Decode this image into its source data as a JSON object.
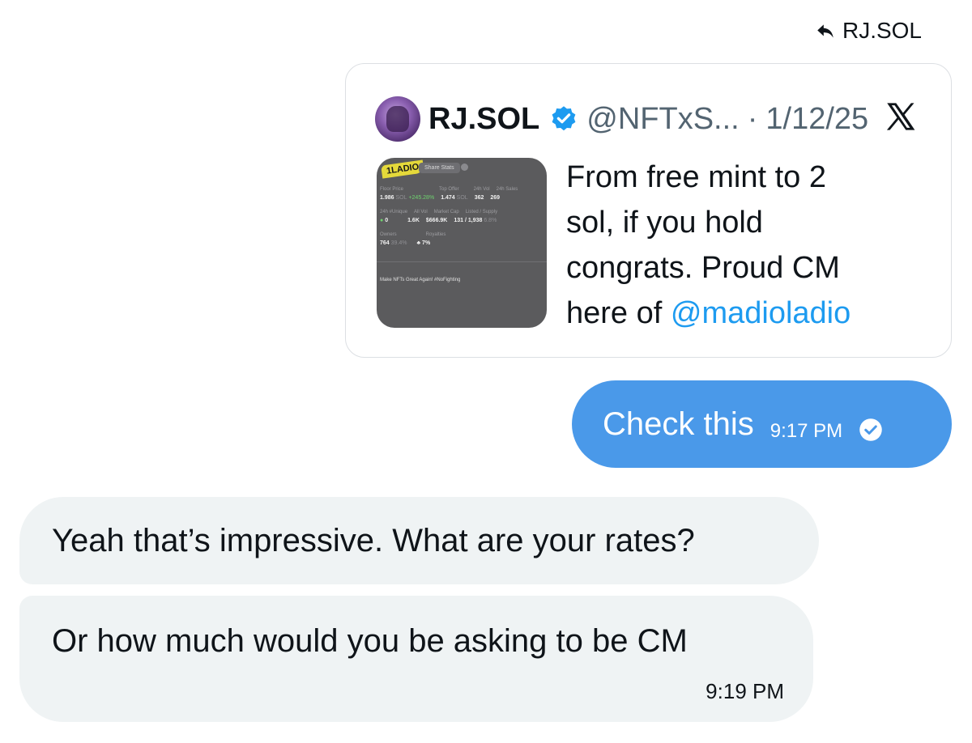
{
  "reply": {
    "label": "RJ.SOL",
    "icon": "reply-arrow-icon"
  },
  "quote": {
    "author_name": "RJ.SOL",
    "verified": true,
    "handle": "@NFTxS...",
    "separator": "·",
    "date": "1/12/25",
    "platform_icon": "x-logo-icon",
    "text_line1": "From free mint to 2",
    "text_line2": "sol, if you hold",
    "text_line3": "congrats. Proud CM",
    "text_prefix": "here of ",
    "mention": "@madioladio",
    "media": {
      "logo": "1LADIO",
      "share_label": "Share Stats",
      "row1_labels": [
        "Floor Price",
        "Top Offer",
        "24h Vol",
        "24h Sales"
      ],
      "row1_value_a": "1.986",
      "row1_unit_a": "SOL",
      "row1_change": "+245.28%",
      "row1_value_b": "1.474",
      "row1_unit_b": "SOL",
      "row1_value_c": "362",
      "row1_value_d": "269",
      "row2_labels": [
        "24h #Unique",
        "All Vol",
        "Market Cap",
        "Listed / Supply"
      ],
      "row2_value_a": "0",
      "row2_value_b": "1.6K",
      "row2_value_c": "$666.9K",
      "row2_value_d": "131 / 1,938",
      "row2_pct": "6.8%",
      "row3_labels": [
        "Owners",
        "Royalties"
      ],
      "row3_value_a": "764",
      "row3_pct": "39.4%",
      "row3_value_b": "7%",
      "tagline": "Make NFTs Great Again! #NoFighting"
    }
  },
  "messages": {
    "sent": {
      "text": "Check this",
      "time": "9:17 PM",
      "status_icon": "seen-check-icon"
    },
    "received": [
      {
        "text": "Yeah that’s impressive. What are your rates?"
      },
      {
        "text": "Or how much would you be asking to be CM",
        "time": "9:19 PM"
      }
    ]
  },
  "colors": {
    "sent_bubble": "#4a99e9",
    "received_bubble": "#eff3f4",
    "link": "#1d9bf0",
    "verified": "#1d9bf0"
  }
}
